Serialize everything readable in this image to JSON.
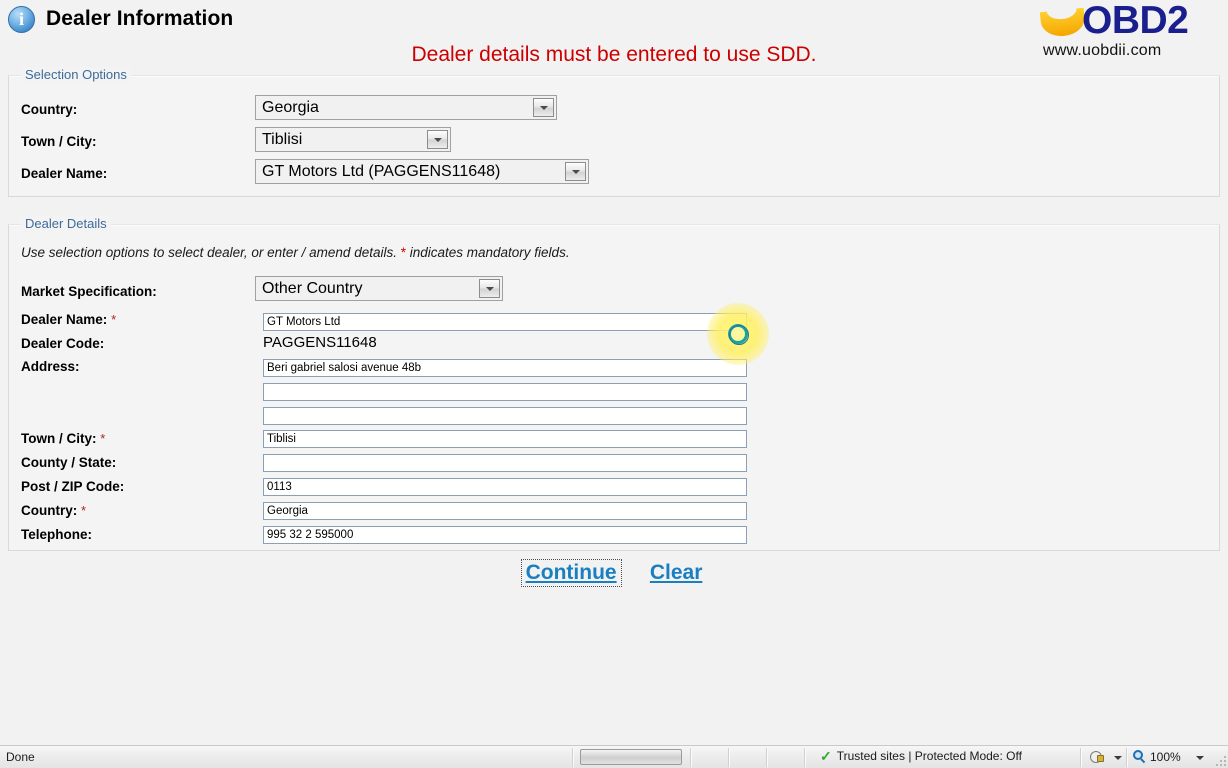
{
  "header": {
    "title": "Dealer Information",
    "info_icon": "info-circle-icon",
    "warning": "Dealer details must be entered to use SDD."
  },
  "logo": {
    "brand": "OBD2",
    "url": "www.uobdii.com",
    "brand_color": "#1a1f8e",
    "smile_color": "#f5a600"
  },
  "selection_options": {
    "legend": "Selection Options",
    "fields": [
      {
        "label": "Country:",
        "value": "Georgia"
      },
      {
        "label": "Town / City:",
        "value": "Tiblisi"
      },
      {
        "label": "Dealer Name:",
        "value": "GT Motors Ltd (PAGGENS11648)"
      }
    ]
  },
  "dealer_details": {
    "legend": "Dealer Details",
    "hint_before": "Use selection options to select dealer, or enter / amend details. ",
    "hint_star": "*",
    "hint_after": " indicates mandatory fields.",
    "market_spec": {
      "label": "Market Specification:",
      "value": "Other Country"
    },
    "dealer_name": {
      "label": "Dealer Name:",
      "required": "*",
      "value": "GT Motors Ltd"
    },
    "dealer_code": {
      "label": "Dealer Code:",
      "value": "PAGGENS11648"
    },
    "address": {
      "label": "Address:",
      "line1": "Beri gabriel salosi avenue 48b",
      "line2": "",
      "line3": ""
    },
    "town_city": {
      "label": "Town / City:",
      "required": "*",
      "value": "Tiblisi"
    },
    "county_state": {
      "label": "County / State:",
      "value": ""
    },
    "post_zip": {
      "label": "Post / ZIP Code:",
      "value": "0113"
    },
    "country": {
      "label": "Country:",
      "required": "*",
      "value": "Georgia"
    },
    "telephone": {
      "label": "Telephone:",
      "value": "995 32 2 595000"
    }
  },
  "actions": {
    "continue_label": "Continue",
    "clear_label": "Clear",
    "link_color": "#1a7fc1"
  },
  "statusbar": {
    "status": "Done",
    "security_zone": "Trusted sites | Protected Mode: Off",
    "check_icon": "green-check-icon",
    "zone_icon": "security-zone-icon",
    "zoom_icon": "magnifier-icon",
    "zoom_level": "100%"
  }
}
